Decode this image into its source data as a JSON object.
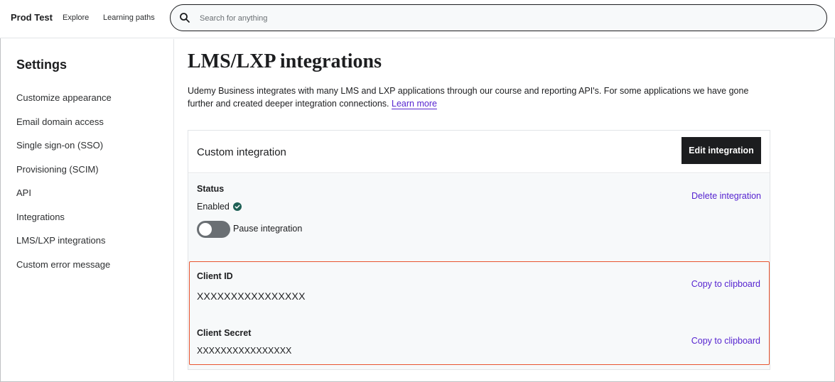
{
  "header": {
    "brand": "Prod Test",
    "nav": {
      "explore": "Explore",
      "learning_paths": "Learning paths"
    },
    "search": {
      "placeholder": "Search for anything",
      "value": ""
    }
  },
  "sidebar": {
    "title": "Settings",
    "items": [
      {
        "label": "Customize appearance"
      },
      {
        "label": "Email domain access"
      },
      {
        "label": "Single sign-on (SSO)"
      },
      {
        "label": "Provisioning (SCIM)"
      },
      {
        "label": "API"
      },
      {
        "label": "Integrations"
      },
      {
        "label": "LMS/LXP integrations"
      },
      {
        "label": "Custom error message"
      }
    ]
  },
  "main": {
    "title": "LMS/LXP integrations",
    "description": "Udemy Business integrates with many LMS and LXP applications through our course and reporting API's. For some applications we have gone further and created deeper integration connections.",
    "learn_more": "Learn more",
    "card": {
      "title": "Custom integration",
      "edit_label": "Edit integration",
      "status_label": "Status",
      "status_value": "Enabled",
      "toggle_label": "Pause integration",
      "toggle_on": false,
      "delete_label": "Delete integration",
      "client_id_label": "Client ID",
      "client_id_value": "XXXXXXXXXXXXXXXX",
      "client_secret_label": "Client Secret",
      "client_secret_value": "XXXXXXXXXXXXXXXX",
      "copy_label": "Copy to clipboard"
    }
  },
  "colors": {
    "accent": "#5624d0",
    "dark": "#1c1d1f",
    "success": "#1e6055",
    "highlight_border": "#e8542f"
  }
}
